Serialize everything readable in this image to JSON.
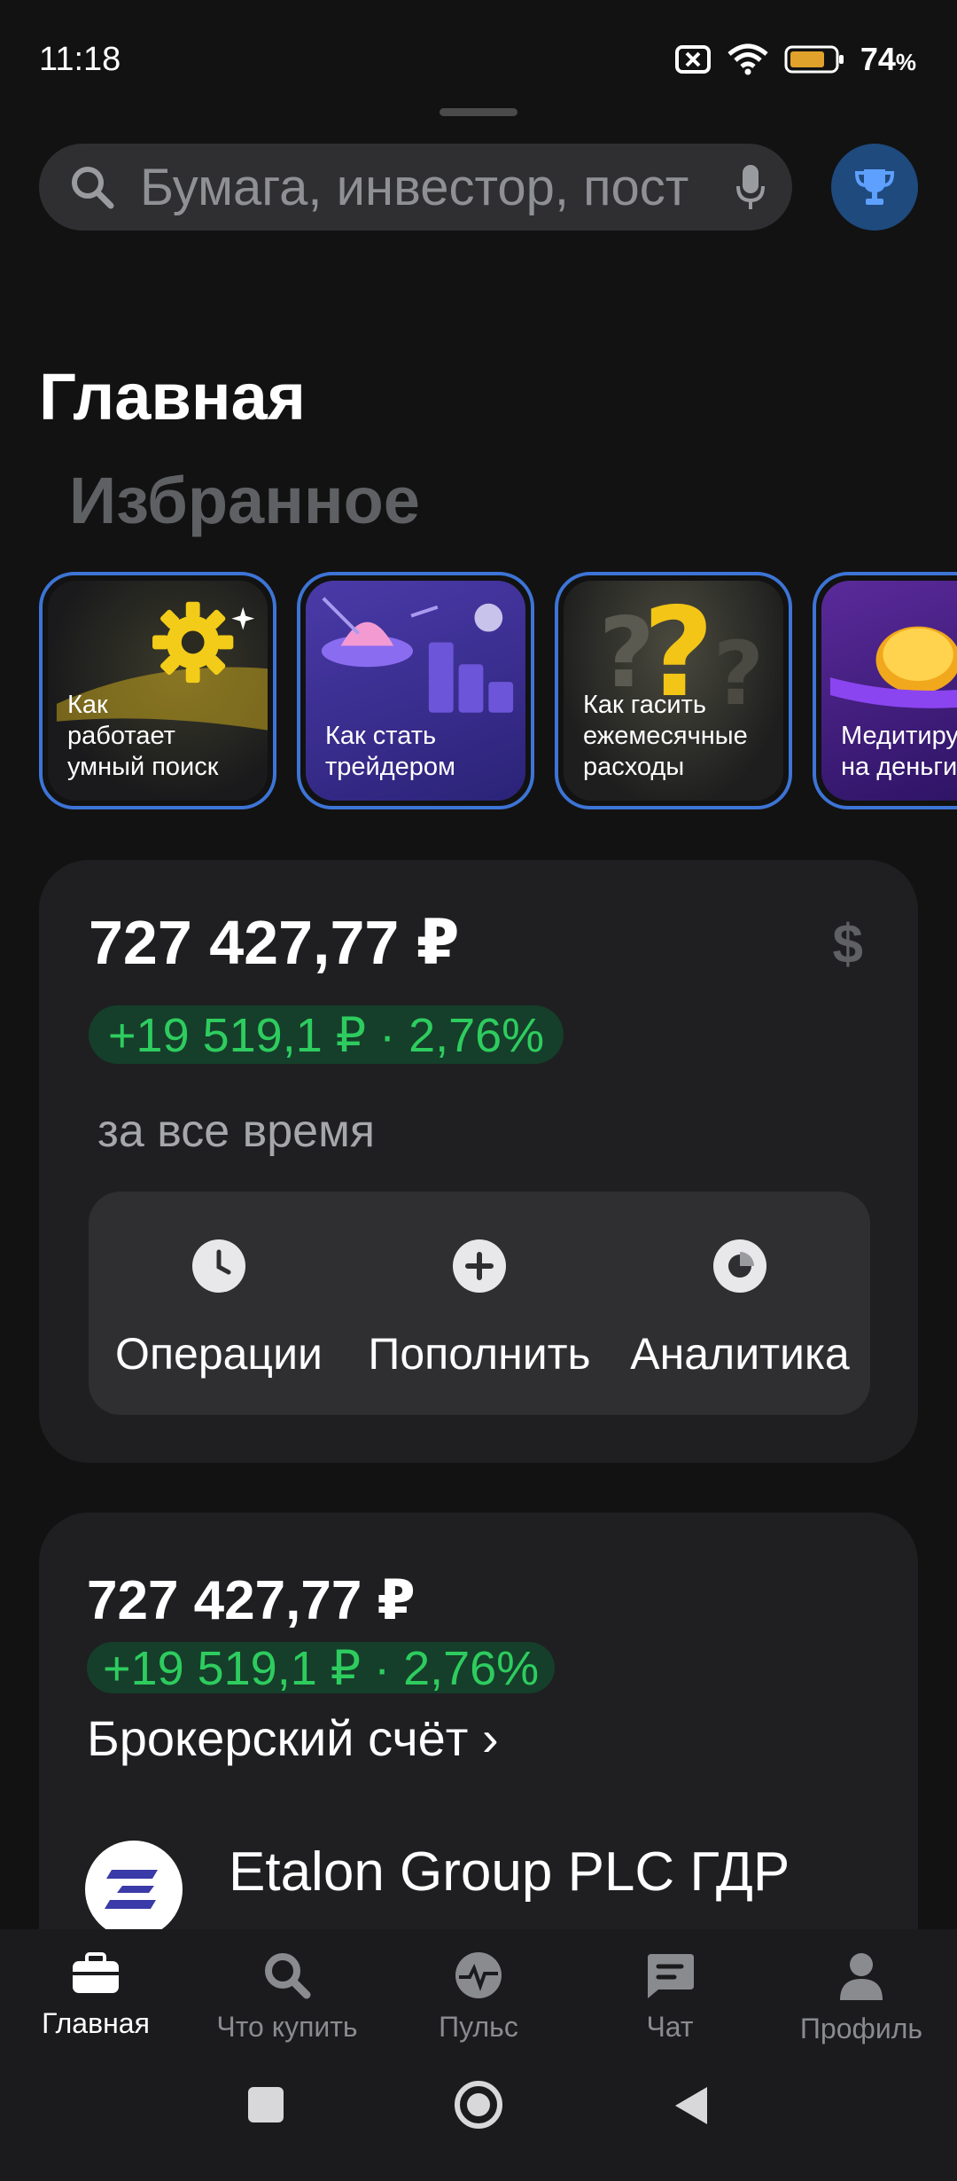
{
  "status_bar": {
    "time": "11:18",
    "battery_percent": "74",
    "battery_unit": "%",
    "icons": [
      "no-sim-icon",
      "wifi-icon",
      "battery-icon"
    ]
  },
  "search": {
    "placeholder": "Бумага, инвестор, пост",
    "icons": [
      "search-icon",
      "mic-icon"
    ]
  },
  "header": {
    "title": "Главная",
    "subtitle": "Избранное"
  },
  "stories": [
    {
      "label": "Как\nработает\nумный поиск"
    },
    {
      "label": "Как стать\nтрейдером"
    },
    {
      "label": "Как гасить\nежемесячные\nрасходы"
    },
    {
      "label": "Медитиру\nна деньги"
    }
  ],
  "portfolio": {
    "total": "727 427,77 ₽",
    "change": "+19 519,1 ₽ · 2,76%",
    "period": "за все время",
    "currency_symbol": "$",
    "actions": [
      {
        "label": "Операции",
        "icon": "clock-icon"
      },
      {
        "label": "Пополнить",
        "icon": "plus-icon"
      },
      {
        "label": "Аналитика",
        "icon": "pie-chart-icon"
      }
    ]
  },
  "account": {
    "total": "727 427,77 ₽",
    "change": "+19 519,1 ₽ · 2,76%",
    "name": "Брокерский счёт ›",
    "holding_name": "Etalon Group PLC ГДР"
  },
  "tabs": [
    {
      "label": "Главная",
      "icon": "briefcase-icon",
      "active": true
    },
    {
      "label": "Что купить",
      "icon": "search-icon",
      "active": false
    },
    {
      "label": "Пульс",
      "icon": "pulse-icon",
      "active": false
    },
    {
      "label": "Чат",
      "icon": "chat-icon",
      "active": false
    },
    {
      "label": "Профиль",
      "icon": "profile-icon",
      "active": false
    }
  ],
  "colors": {
    "background": "#121212",
    "card": "#1f1f21",
    "accent_blue": "#3d74d6",
    "positive_green": "#2ecc5f"
  }
}
